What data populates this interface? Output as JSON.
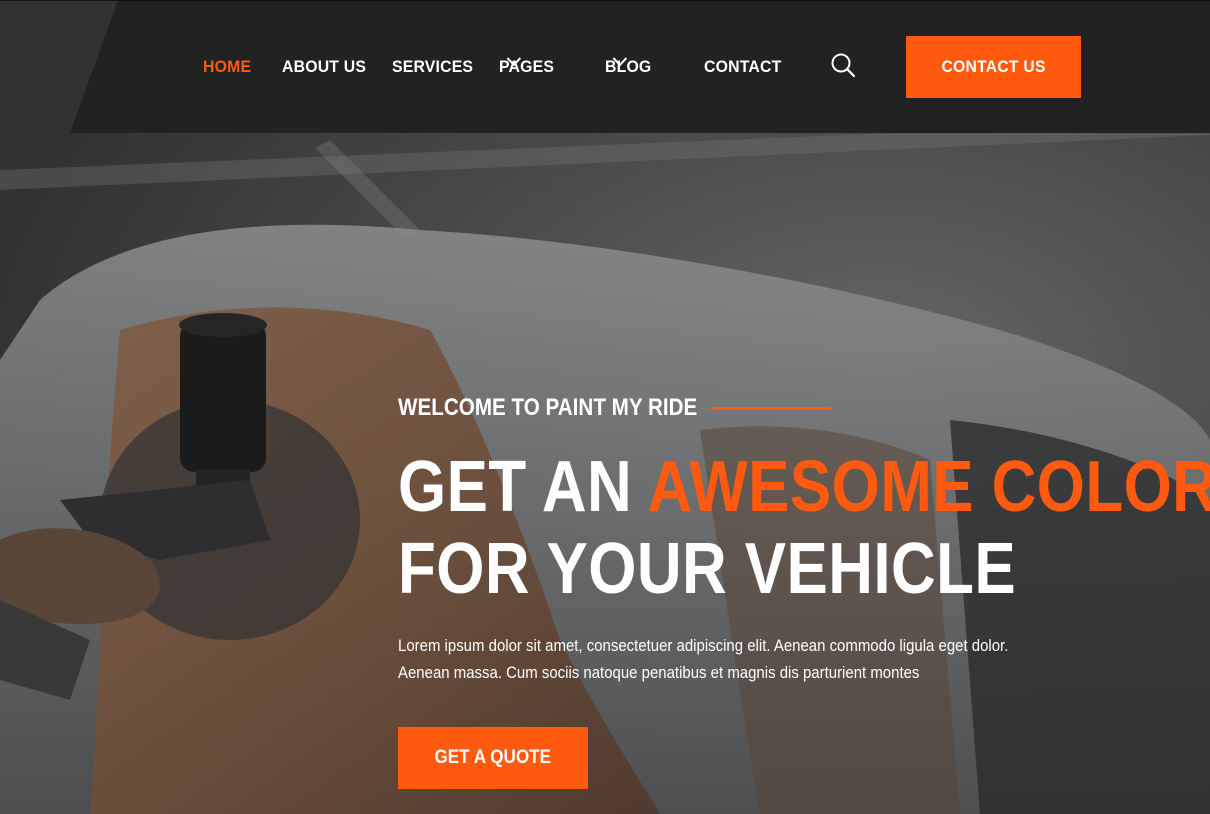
{
  "colors": {
    "accent": "#ff5a0f",
    "topbar": "#222222",
    "text": "#ffffff"
  },
  "nav": {
    "items": [
      {
        "label": "HOME",
        "active": true,
        "dropdown": false
      },
      {
        "label": "ABOUT US",
        "active": false,
        "dropdown": false
      },
      {
        "label": "SERVICES",
        "active": false,
        "dropdown": false
      },
      {
        "label": "PAGES",
        "active": false,
        "dropdown": true
      },
      {
        "label": "BLOG",
        "active": false,
        "dropdown": true
      },
      {
        "label": "CONTACT",
        "active": false,
        "dropdown": false
      }
    ],
    "search_icon": "search-icon",
    "dropdown_icon": "chevron-down-icon",
    "cta_label": "CONTACT US"
  },
  "hero": {
    "tagline": "WELCOME TO PAINT MY RIDE",
    "headline_part1": "GET AN ",
    "headline_accent": "AWESOME COLOR",
    "headline_line2": "FOR YOUR VEHICLE",
    "lead": "Lorem ipsum dolor sit amet, consectetuer adipiscing elit. Aenean commodo ligula eget dolor. Aenean massa. Cum sociis natoque penatibus et magnis dis parturient montes",
    "button_label": "GET A QUOTE"
  }
}
